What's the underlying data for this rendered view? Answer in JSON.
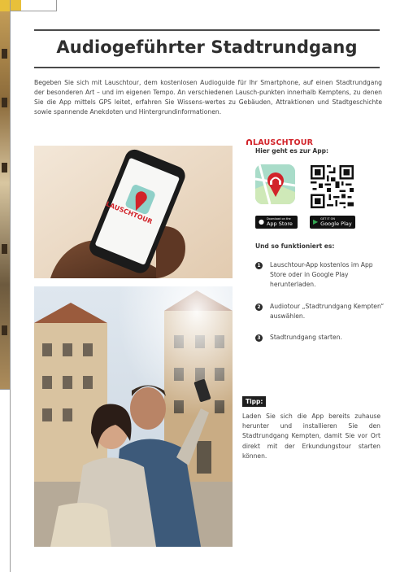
{
  "title": "Audiogeführter Stadtrundgang",
  "intro": "Begeben Sie sich mit Lauschtour, dem kostenlosen Audioguide für Ihr Smartphone, auf einen Stadtrundgang der besonderen Art – und im eigenen Tempo. An verschiedenen Lausch-punkten innerhalb Kemptens, zu denen Sie die App mittels GPS leitet, erfahren Sie Wissens-wertes zu Gebäuden, Attraktionen und Stadtgeschichte sowie spannende Anekdoten und Hintergrundinformationen.",
  "phone_screen_brand": "LAUSCHTOUR",
  "brand": "LAUSCHTOUR",
  "cta": "Hier geht es zur App:",
  "stores": {
    "apple_small": "Download on the",
    "apple_label": "App Store",
    "google_small": "GET IT ON",
    "google_label": "Google Play"
  },
  "how_title": "Und so funktioniert es:",
  "steps": [
    {
      "num": "1",
      "text": "Lauschtour-App kostenlos im App Store oder in Google Play herunterladen."
    },
    {
      "num": "2",
      "text": "Audiotour „Stadtrundgang Kempten“ auswählen."
    },
    {
      "num": "3",
      "text": "Stadtrundgang starten."
    }
  ],
  "tip_label": "Tipp:",
  "tip_text": "Laden Sie sich die App bereits zuhause herunter und installieren Sie den Stadtrundgang Kempten, damit Sie vor Ort direkt mit der Erkundungstour starten können.",
  "colors": {
    "brand_red": "#d2232a",
    "text": "#444444",
    "rule": "#4a4a4a"
  }
}
